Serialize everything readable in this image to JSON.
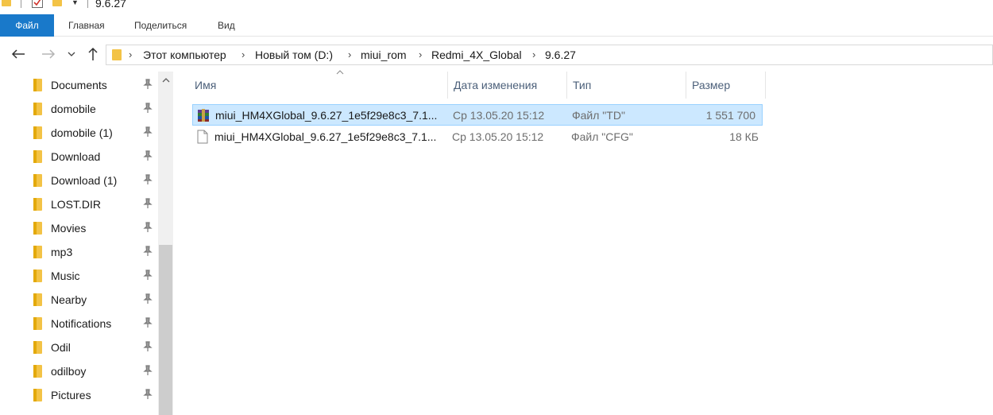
{
  "window": {
    "title": "9.6.27"
  },
  "ribbon": {
    "tabs": [
      "Файл",
      "Главная",
      "Поделиться",
      "Вид"
    ]
  },
  "address_bar": {
    "crumbs": [
      "Этот компьютер",
      "Новый том (D:)",
      "miui_rom",
      "Redmi_4X_Global",
      "9.6.27"
    ]
  },
  "sidebar": {
    "items": [
      {
        "label": "Documents",
        "icon": "folder-icon",
        "pinned": true
      },
      {
        "label": "domobile",
        "icon": "folder-icon",
        "pinned": true
      },
      {
        "label": "domobile (1)",
        "icon": "folder-icon",
        "pinned": true
      },
      {
        "label": "Download",
        "icon": "folder-icon",
        "pinned": true
      },
      {
        "label": "Download (1)",
        "icon": "folder-icon",
        "pinned": true
      },
      {
        "label": "LOST.DIR",
        "icon": "folder-icon",
        "pinned": true
      },
      {
        "label": "Movies",
        "icon": "folder-icon",
        "pinned": true
      },
      {
        "label": "mp3",
        "icon": "folder-icon",
        "pinned": true
      },
      {
        "label": "Music",
        "icon": "folder-icon",
        "pinned": true
      },
      {
        "label": "Nearby",
        "icon": "folder-icon",
        "pinned": true
      },
      {
        "label": "Notifications",
        "icon": "folder-icon",
        "pinned": true
      },
      {
        "label": "Odil",
        "icon": "folder-icon",
        "pinned": true
      },
      {
        "label": "odilboy",
        "icon": "folder-icon",
        "pinned": true
      },
      {
        "label": "Pictures",
        "icon": "folder-icon",
        "pinned": true
      }
    ]
  },
  "file_list": {
    "columns": {
      "name": "Имя",
      "date": "Дата изменения",
      "type": "Тип",
      "size": "Размер"
    },
    "rows": [
      {
        "name": "miui_HM4XGlobal_9.6.27_1e5f29e8c3_7.1...",
        "date": "Ср 13.05.20 15:12",
        "type": "Файл \"TD\"",
        "size": "1 551 700",
        "icon": "archive-icon",
        "selected": true
      },
      {
        "name": "miui_HM4XGlobal_9.6.27_1e5f29e8c3_7.1...",
        "date": "Ср 13.05.20 15:12",
        "type": "Файл \"CFG\"",
        "size": "18 КБ",
        "icon": "document-icon",
        "selected": false
      }
    ]
  },
  "colors": {
    "accent": "#1979ca",
    "selection": "#cce8ff",
    "selection_border": "#99d1ff",
    "folder": "#f3c346",
    "header_text": "#4c607a"
  }
}
